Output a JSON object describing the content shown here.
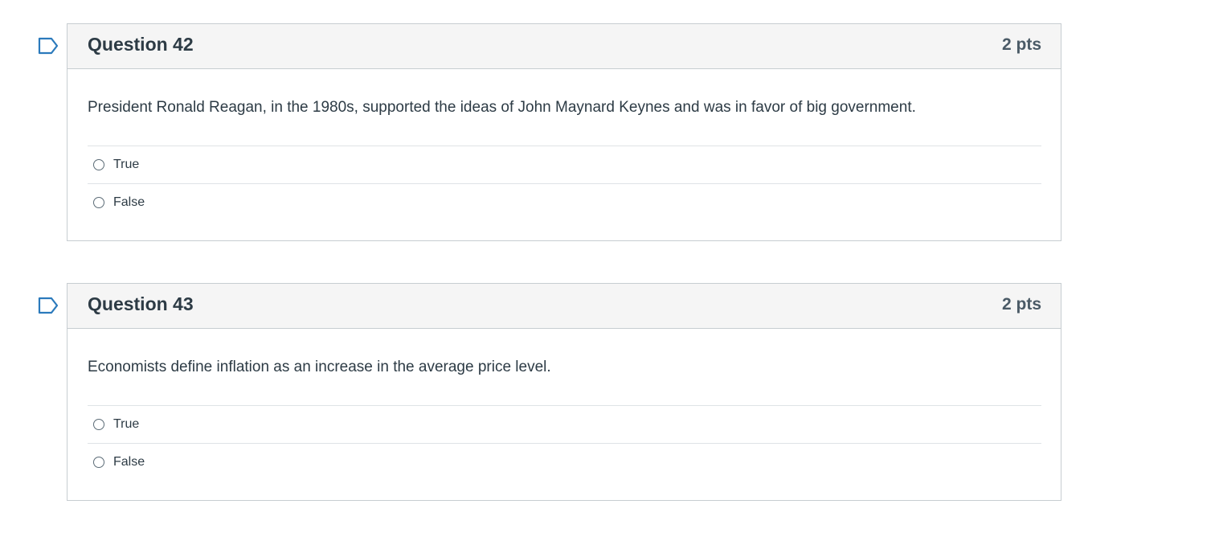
{
  "questions": [
    {
      "title": "Question 42",
      "points": "2 pts",
      "text": "President Ronald Reagan, in the 1980s, supported the ideas of John Maynard Keynes and was in favor of big government.",
      "answers": [
        "True",
        "False"
      ]
    },
    {
      "title": "Question 43",
      "points": "2 pts",
      "text": "Economists define inflation as an increase in the average price level.",
      "answers": [
        "True",
        "False"
      ]
    }
  ],
  "icons": {
    "flag": "bookmark-flag-icon",
    "radio": "radio-button"
  },
  "colors": {
    "flag_stroke": "#2b7abc",
    "header_bg": "#f5f5f5",
    "border": "#c7cdd1",
    "text": "#2d3b45"
  }
}
